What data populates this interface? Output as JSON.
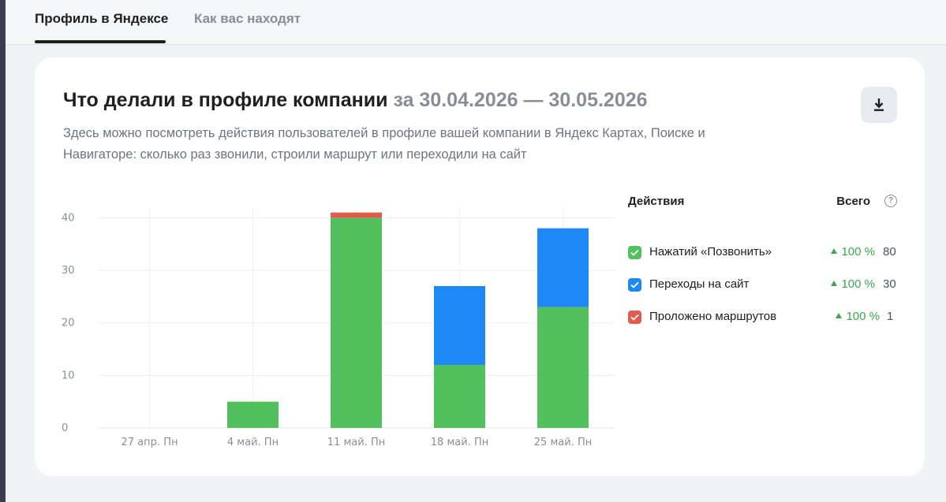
{
  "tabs": [
    {
      "label": "Профиль в Яндексе",
      "active": true
    },
    {
      "label": "Как вас находят",
      "active": false
    }
  ],
  "card": {
    "title": "Что делали в профиле компании",
    "period": "за 30.04.2026 — 30.05.2026",
    "description": "Здесь можно посмотреть действия пользователей в профиле вашей компании в Яндекс Картах, Поиске и Навигаторе: сколько раз звонили, строили маршрут или переходили на сайт",
    "download_icon": "download-icon"
  },
  "legend": {
    "header_actions": "Действия",
    "header_total": "Всего",
    "help_icon": "?",
    "items": [
      {
        "label": "Нажатий «Позвонить»",
        "change": "100 %",
        "total": "80",
        "color": "#52c05c",
        "checked": true
      },
      {
        "label": "Переходы на сайт",
        "change": "100 %",
        "total": "30",
        "color": "#1e88f6",
        "checked": true
      },
      {
        "label": "Проложено маршрутов",
        "change": "100 %",
        "total": "1",
        "color": "#e35b4f",
        "checked": true
      }
    ]
  },
  "chart_data": {
    "type": "bar",
    "stacked": true,
    "categories": [
      "27 апр. Пн",
      "4 май. Пн",
      "11 май. Пн",
      "18 май. Пн",
      "25 май. Пн"
    ],
    "series": [
      {
        "name": "Нажатий «Позвонить»",
        "color": "#52c05c",
        "values": [
          0,
          5,
          40,
          12,
          23
        ]
      },
      {
        "name": "Переходы на сайт",
        "color": "#1e88f6",
        "values": [
          0,
          0,
          0,
          15,
          15
        ]
      },
      {
        "name": "Проложено маршрутов",
        "color": "#e35b4f",
        "values": [
          0,
          0,
          1,
          0,
          0
        ]
      }
    ],
    "yticks": [
      0,
      10,
      20,
      30,
      40
    ],
    "ylim": [
      0,
      42
    ],
    "grid": true
  }
}
